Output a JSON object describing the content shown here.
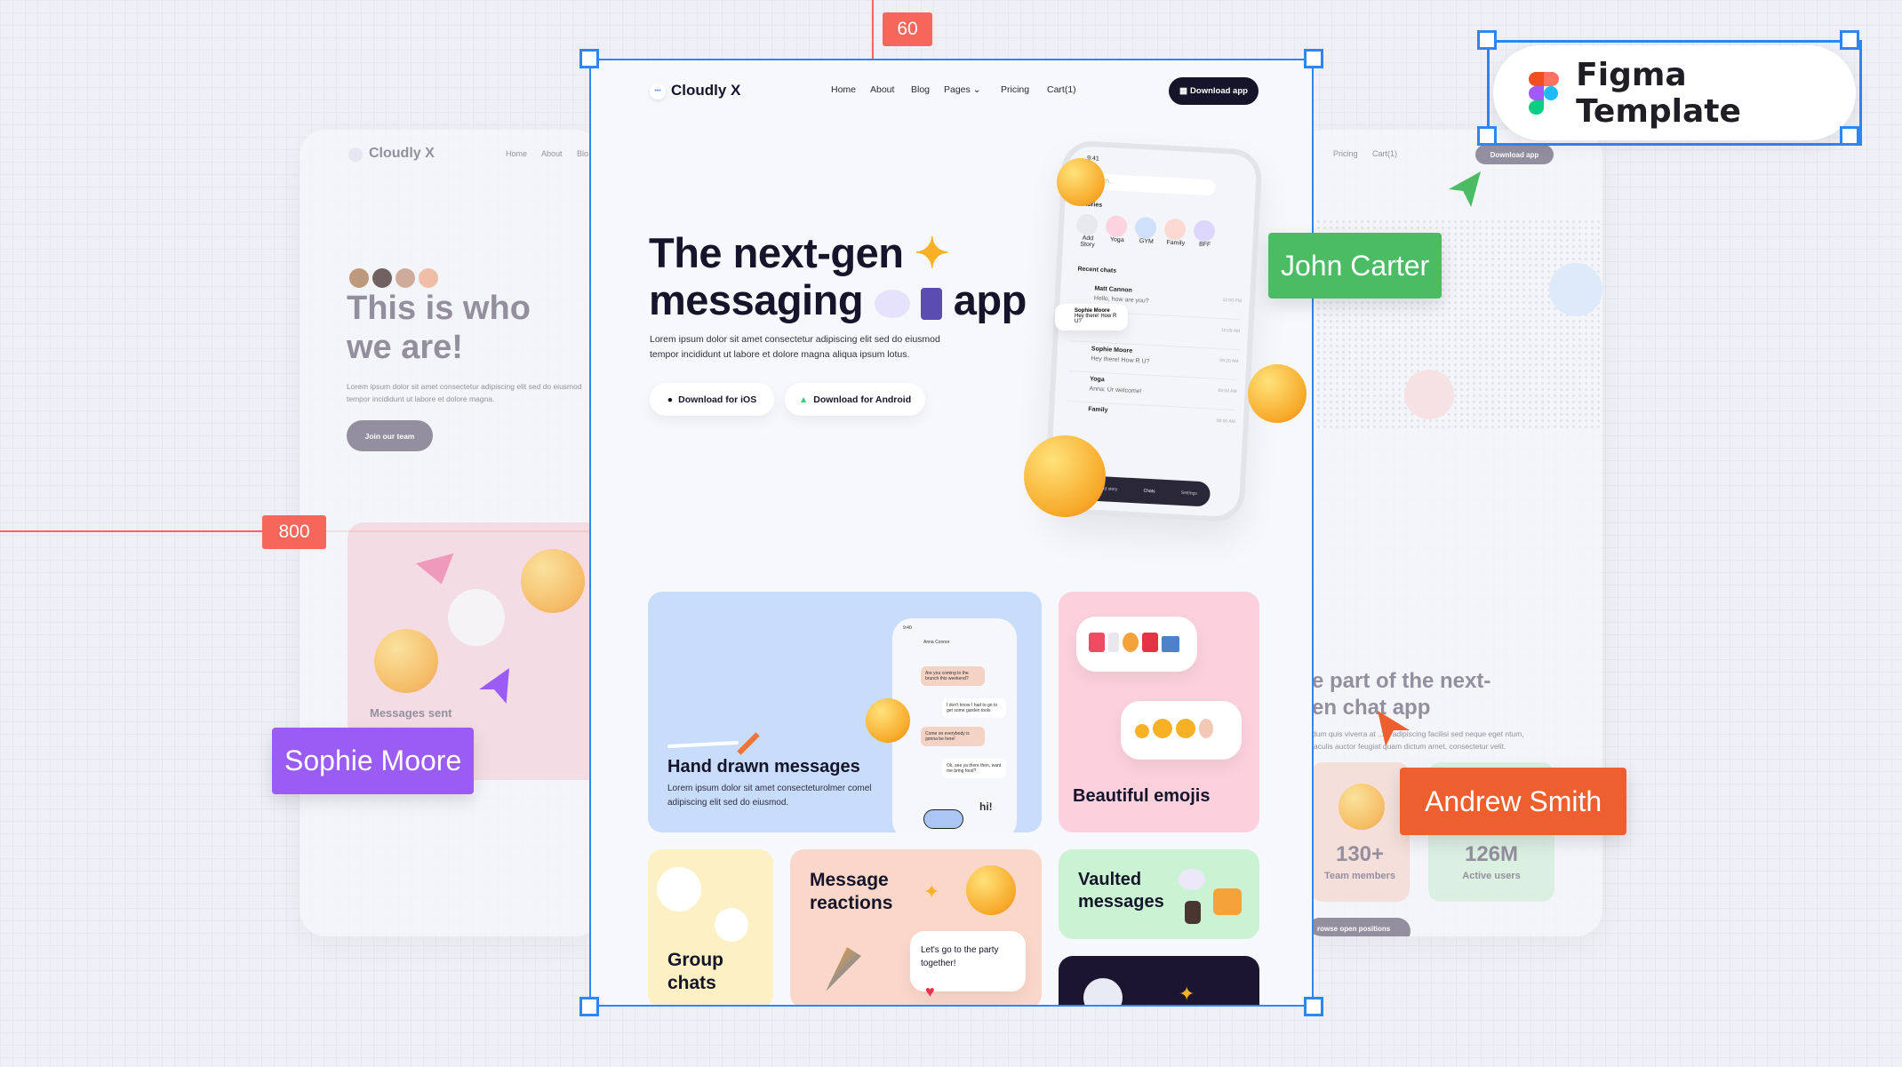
{
  "guides": {
    "top_value": "60",
    "left_value": "800",
    "color": "#f4675a"
  },
  "badge": {
    "title": "Figma Template"
  },
  "cursors": [
    {
      "name": "John Carter",
      "color": "#4bbb64"
    },
    {
      "name": "Sophie Moore",
      "color": "#9b5cf6"
    },
    {
      "name": "Andrew Smith",
      "color": "#ee5f2f"
    }
  ],
  "left_page": {
    "logo": "Cloudly X",
    "nav": [
      "Home",
      "About",
      "Blo"
    ],
    "title_l1": "This is who",
    "title_l2": "we are!",
    "paragraph": "Lorem ipsum dolor sit amet consectetur adipiscing elit sed do eiusmod tempor incididunt ut labore et dolore magna.",
    "cta": "Join our team",
    "stat_label": "Messages sent"
  },
  "right_page": {
    "nav": [
      "Pricing",
      "Cart(1)"
    ],
    "cta": "Download app",
    "title_l1": "e part of the next-",
    "title_l2": "en chat app",
    "paragraph": "dum quis viverra at ... n adipiscing facilisi sed neque eget ntum, iaculis auctor feugiat quam dictum amet, consectetur velit.",
    "stats": [
      {
        "value": "130+",
        "label": "Team members"
      },
      {
        "value": "126M",
        "label": "Active users"
      }
    ],
    "browse": "rowse open positions"
  },
  "page": {
    "logo": "Cloudly X",
    "nav": {
      "home": "Home",
      "about": "About",
      "blog": "Blog",
      "pages": "Pages",
      "pricing": "Pricing",
      "cart": "Cart(1)"
    },
    "download_app": "Download app",
    "hero": {
      "title_l1": "The next-gen",
      "title_l2a": "messaging",
      "title_l2b": "app",
      "paragraph": "Lorem ipsum dolor sit amet consectetur adipiscing elit sed do eiusmod tempor incididunt ut labore et dolore magna aliqua ipsum lotus.",
      "ios": "Download for iOS",
      "android": "Download for Android"
    },
    "phone": {
      "time": "9:41",
      "search": "Search...",
      "stories_title": "Stories",
      "stories": [
        "Add Story",
        "Yoga",
        "GYM",
        "Family",
        "BFF"
      ],
      "recent": "Recent chats",
      "chats": [
        {
          "name": "Matt Cannon",
          "msg": "Hello, how are you?",
          "time": "12:00 PM"
        },
        {
          "name": "Sophie Moore",
          "msg": "Hey there! How R U?",
          "time": "10:00 AM"
        },
        {
          "name": "Sophie Moore",
          "msg": "Hey there! How R U?",
          "time": "09:20 AM"
        },
        {
          "name": "Yoga",
          "msg": "Anna: Ur welcome!",
          "time": "09:00 AM"
        },
        {
          "name": "Family",
          "msg": "",
          "time": "08:00 AM"
        }
      ],
      "tabs": [
        "Add story",
        "Chats",
        "Settings"
      ]
    },
    "features": {
      "hand_drawn": {
        "title": "Hand drawn messages",
        "text": "Lorem ipsum dolor sit amet consecteturolmer comel adipiscing elit sed do eiusmod.",
        "chat_contact": "Anna Connor",
        "chat_time": "9:40",
        "bubbles": [
          "Are you coming to the brunch this weekend?",
          "I don't know I had to go to get some garden tools",
          "Come on everybody is gonna be here!",
          "Ok, see ya there then, want me bring food?"
        ],
        "doodle": "hi!"
      },
      "emojis": {
        "title": "Beautiful emojis"
      },
      "group": {
        "title_l1": "Group",
        "title_l2": "chats"
      },
      "reactions": {
        "title_l1": "Message",
        "title_l2": "reactions",
        "bubble": "Let's go to the party together!"
      },
      "vaulted": {
        "title_l1": "Vaulted",
        "title_l2": "messages"
      }
    },
    "colors": {
      "blue": "#c8dcfb",
      "pink": "#fcd0dd",
      "yellow": "#fdf0c4",
      "peach": "#fbd7c9",
      "green": "#c9f3d3",
      "dark": "#1b1530"
    }
  }
}
